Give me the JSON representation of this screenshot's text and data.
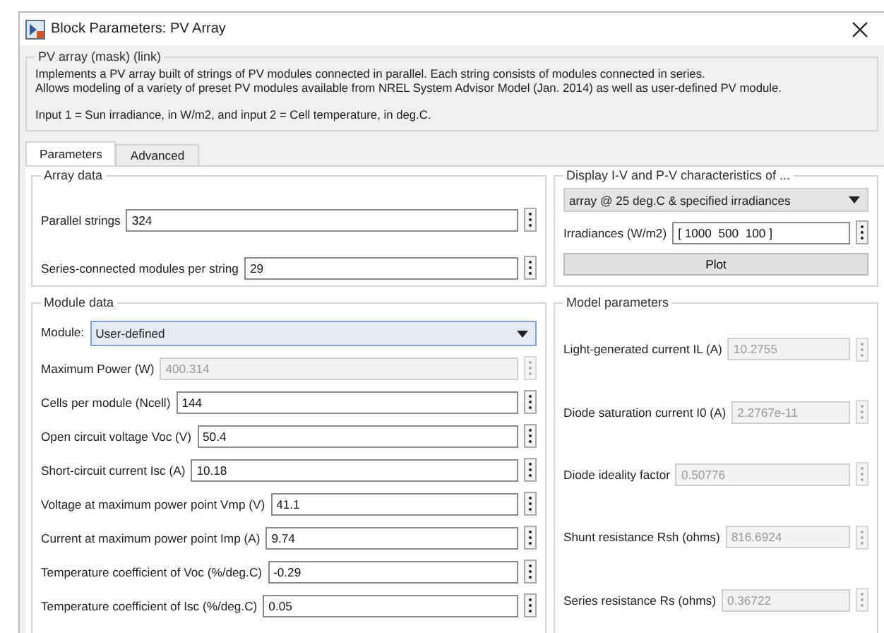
{
  "window": {
    "title": "Block Parameters: PV Array"
  },
  "mask": {
    "title": "PV array (mask) (link)",
    "lines": [
      "Implements a PV array built of strings of PV modules connected in parallel. Each string consists of modules connected in series.",
      "Allows modeling of a variety of preset PV modules available from NREL System Advisor Model (Jan. 2014) as well as user-defined PV module."
    ],
    "note": "Input 1 = Sun irradiance, in W/m2, and input 2 = Cell temperature, in deg.C."
  },
  "tabs": [
    {
      "label": "Parameters",
      "selected": true
    },
    {
      "label": "Advanced",
      "selected": false
    }
  ],
  "array_data": {
    "title": "Array data",
    "fields": [
      {
        "label": "Parallel strings",
        "value": "324",
        "disabled": false
      },
      {
        "label": "Series-connected modules per string",
        "value": "29",
        "disabled": false
      }
    ]
  },
  "module_data": {
    "title": "Module data",
    "module": {
      "label": "Module:",
      "value": "User-defined"
    },
    "fields": [
      {
        "label": "Maximum Power (W)",
        "value": "400.314",
        "disabled": true
      },
      {
        "label": "Cells per module (Ncell)",
        "value": "144",
        "disabled": false
      },
      {
        "label": "Open circuit voltage  Voc (V)",
        "value": "50.4",
        "disabled": false
      },
      {
        "label": "Short-circuit current Isc (A)",
        "value": "10.18",
        "disabled": false
      },
      {
        "label": "Voltage at maximum power point Vmp (V)",
        "value": "41.1",
        "disabled": false
      },
      {
        "label": "Current at maximum power point Imp (A)",
        "value": "9.74",
        "disabled": false
      },
      {
        "label": "Temperature coefficient of Voc (%/deg.C)",
        "value": "-0.29",
        "disabled": false
      },
      {
        "label": "Temperature coefficient of Isc (%/deg.C)",
        "value": "0.05",
        "disabled": false
      }
    ]
  },
  "display": {
    "title": "Display  I-V and P-V characteristics of ...",
    "option": "array @ 25 deg.C & specified irradiances",
    "fields": [
      {
        "label": "Irradiances (W/m2)",
        "value": "[ 1000  500  100 ]",
        "disabled": false
      }
    ],
    "button": "Plot"
  },
  "model_parameters": {
    "title": "Model parameters",
    "fields": [
      {
        "label": "Light-generated current IL (A)",
        "value": "10.2755",
        "disabled": true
      },
      {
        "label": "Diode saturation current I0 (A)",
        "value": "2.2767e-11",
        "disabled": true
      },
      {
        "label": "Diode ideality factor",
        "value": "0.50776",
        "disabled": true
      },
      {
        "label": "Shunt resistance Rsh (ohms)",
        "value": "816.6924",
        "disabled": true
      },
      {
        "label": "Series resistance Rs (ohms)",
        "value": "0.36722",
        "disabled": true
      }
    ]
  }
}
